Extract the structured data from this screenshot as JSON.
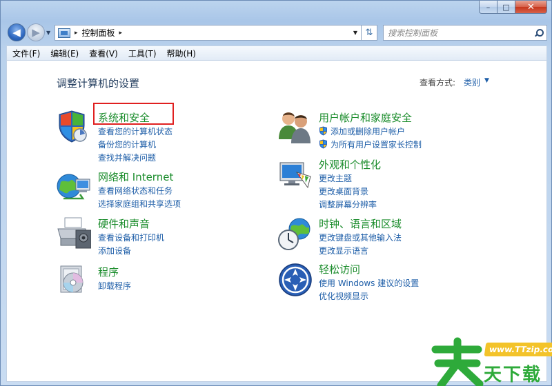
{
  "window": {
    "min_label": "–",
    "max_label": "□",
    "close_label": "✕"
  },
  "address": {
    "path": "控制面板",
    "separator": "▸",
    "search_placeholder": "搜索控制面板"
  },
  "menu": [
    "文件(F)",
    "编辑(E)",
    "查看(V)",
    "工具(T)",
    "帮助(H)"
  ],
  "page": {
    "title": "调整计算机的设置",
    "view_by_label": "查看方式:",
    "view_by_value": "类别"
  },
  "categories": [
    {
      "title": "系统和安全",
      "icon": "shield-flag-icon",
      "links": [
        "查看您的计算机状态",
        "备份您的计算机",
        "查找并解决问题"
      ]
    },
    {
      "title": "网络和 Internet",
      "icon": "network-globe-icon",
      "links": [
        "查看网络状态和任务",
        "选择家庭组和共享选项"
      ]
    },
    {
      "title": "硬件和声音",
      "icon": "printer-icon",
      "links": [
        "查看设备和打印机",
        "添加设备"
      ]
    },
    {
      "title": "程序",
      "icon": "program-disc-icon",
      "links": [
        "卸载程序"
      ]
    },
    {
      "title": "用户帐户和家庭安全",
      "icon": "users-icon",
      "links": [
        "添加或删除用户帐户",
        "为所有用户设置家长控制"
      ]
    },
    {
      "title": "外观和个性化",
      "icon": "monitor-palette-icon",
      "links": [
        "更改主题",
        "更改桌面背景",
        "调整屏幕分辨率"
      ]
    },
    {
      "title": "时钟、语言和区域",
      "icon": "clock-globe-icon",
      "links": [
        "更改键盘或其他输入法",
        "更改显示语言"
      ]
    },
    {
      "title": "轻松访问",
      "icon": "ease-of-access-icon",
      "links": [
        "使用 Windows 建议的设置",
        "优化视频显示"
      ]
    }
  ],
  "watermark": {
    "url": "www.TTzip.com",
    "text": "天下载"
  },
  "colors": {
    "category_title": "#1a8c2b",
    "link": "#1e5ea8",
    "highlight_box": "#e02020"
  }
}
